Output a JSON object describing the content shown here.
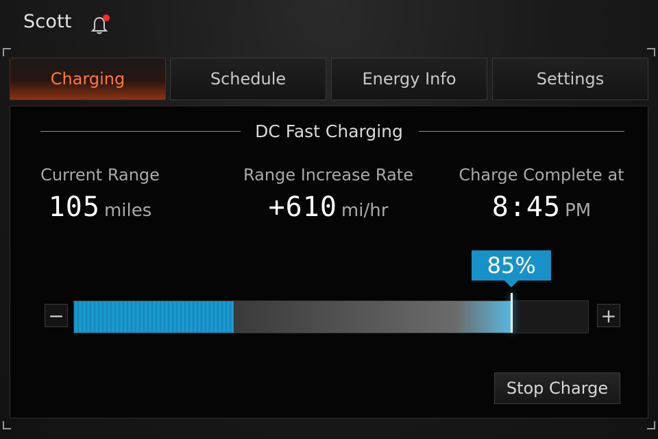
{
  "header": {
    "user_name": "Scott",
    "notification_icon": "bell-icon"
  },
  "tabs": [
    {
      "label": "Charging",
      "active": true
    },
    {
      "label": "Schedule",
      "active": false
    },
    {
      "label": "Energy Info",
      "active": false
    },
    {
      "label": "Settings",
      "active": false
    }
  ],
  "panel": {
    "title": "DC Fast Charging",
    "stats": [
      {
        "label": "Current Range",
        "value": "105",
        "unit": "miles"
      },
      {
        "label": "Range Increase Rate",
        "value": "+610",
        "unit": "mi/hr"
      },
      {
        "label": "Charge Complete at",
        "value": "8:45",
        "unit": "PM"
      }
    ],
    "charge": {
      "current_level": 0.31,
      "target_label": "85%",
      "target_level": 0.85,
      "decrease_label": "−",
      "increase_label": "+"
    },
    "stop_button_label": "Stop Charge"
  },
  "colors": {
    "accent_orange": "#ff7a3a",
    "accent_blue": "#1792c8",
    "alert_red": "#ff2a2a"
  }
}
